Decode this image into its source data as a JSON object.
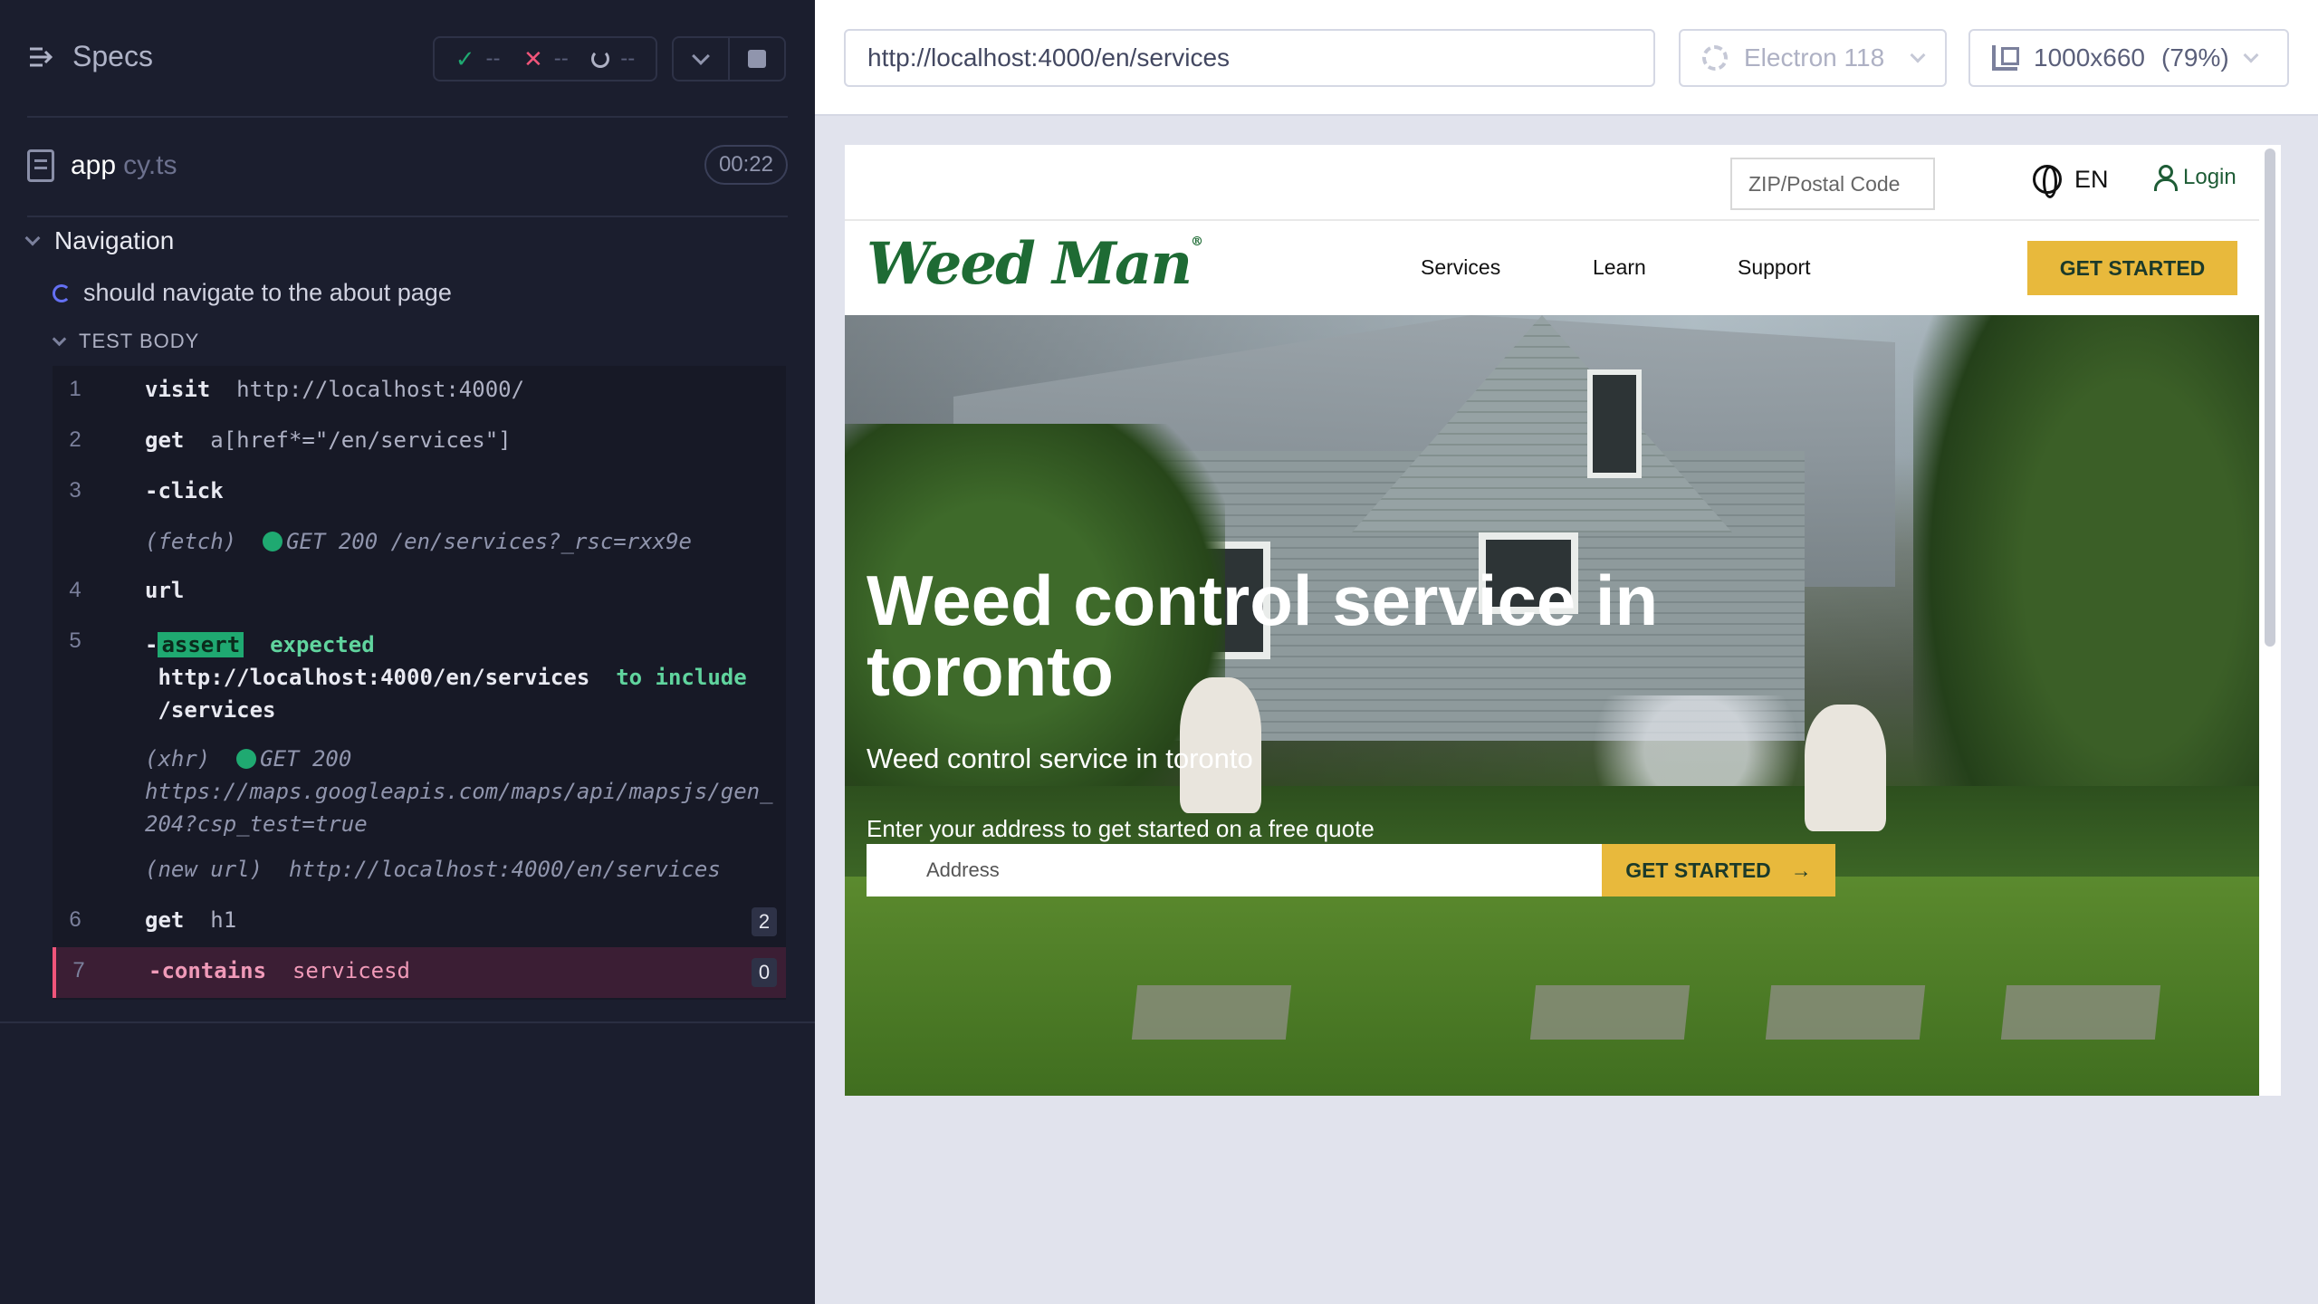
{
  "reporter": {
    "specs_label": "Specs",
    "stats": {
      "passed": "--",
      "failed": "--",
      "pending": "--"
    },
    "spec_file": {
      "name": "app",
      "ext": "cy.ts",
      "duration": "00:22"
    },
    "suite_title": "Navigation",
    "test_title": "should navigate to the about page",
    "body_label": "TEST BODY",
    "commands": [
      {
        "num": "1",
        "name": "visit",
        "message": "http://localhost:4000/"
      },
      {
        "num": "2",
        "name": "get",
        "message": "a[href*=\"/en/services\"]"
      },
      {
        "num": "3",
        "name": "-click",
        "message": ""
      },
      {
        "sub_prefix": "(fetch)",
        "sub_text": "GET 200 /en/services?_rsc=rxx9e"
      },
      {
        "num": "4",
        "name": "url",
        "message": ""
      },
      {
        "num": "5",
        "name": "-",
        "assert_tag": "assert",
        "expected_word": "expected",
        "url_value": "http://localhost:4000/en/services",
        "to_include": "to include",
        "include_value": "/services"
      },
      {
        "sub_prefix": "(xhr)",
        "sub_text": "GET 200",
        "sub_text_2": "https://maps.googleapis.com/maps/api/mapsjs/gen_",
        "sub_text_3": "204?csp_test=true"
      },
      {
        "sub_prefix": "(new url)",
        "sub_text": "http://localhost:4000/en/services"
      },
      {
        "num": "6",
        "name": "get",
        "message": "h1",
        "count": "2"
      },
      {
        "num": "7",
        "name": "-contains",
        "message": "servicesd",
        "count": "0",
        "status": "failed"
      }
    ],
    "colors": {
      "bg": "#1b1e2e",
      "pass": "#1fa971",
      "fail": "#f0557a"
    }
  },
  "aut_header": {
    "url": "http://localhost:4000/en/services",
    "browser": "Electron 118",
    "viewport": "1000x660",
    "scale": "(79%)"
  },
  "site": {
    "zip_placeholder": "ZIP/Postal Code",
    "language": "EN",
    "login": "Login",
    "logo_text": "Weed Man",
    "logo_mark": "®",
    "nav": [
      "Services",
      "Learn",
      "Support"
    ],
    "cta": "GET STARTED",
    "hero": {
      "title": "Weed control service in toronto",
      "subtitle": "Weed control service in toronto",
      "address_label": "Enter your address to get started on a free quote",
      "address_placeholder": "Address",
      "button": "GET STARTED",
      "button_icon": "→"
    },
    "colors": {
      "brand_green": "#1e6b34",
      "cta_yellow": "#e8b93c"
    }
  }
}
